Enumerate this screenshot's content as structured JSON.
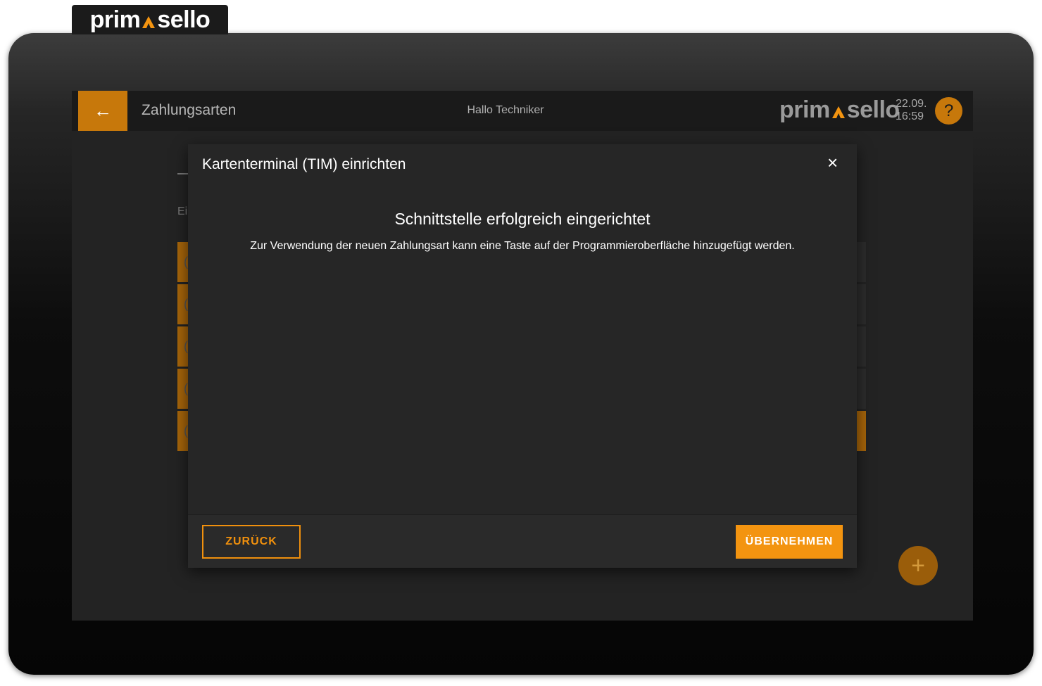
{
  "brand": {
    "name_left": "prim",
    "name_right": "sello",
    "accent_color": "#f39410"
  },
  "header": {
    "back_icon": "arrow-left-icon",
    "back_symbol": "←",
    "title": "Zahlungsarten",
    "greeting": "Hallo Techniker",
    "date": "22.09.",
    "time": "16:59",
    "help_symbol": "?"
  },
  "background": {
    "hint_fragment": "Ei",
    "row_glyph": "(",
    "add_symbol": "+"
  },
  "modal": {
    "title": "Kartenterminal (TIM) einrichten",
    "close_symbol": "×",
    "heading": "Schnittstelle erfolgreich eingerichtet",
    "text": "Zur Verwendung der neuen Zahlungsart kann eine Taste auf der Programmieroberfläche hinzugefügt werden.",
    "back_label": "ZURÜCK",
    "apply_label": "ÜBERNEHMEN"
  }
}
